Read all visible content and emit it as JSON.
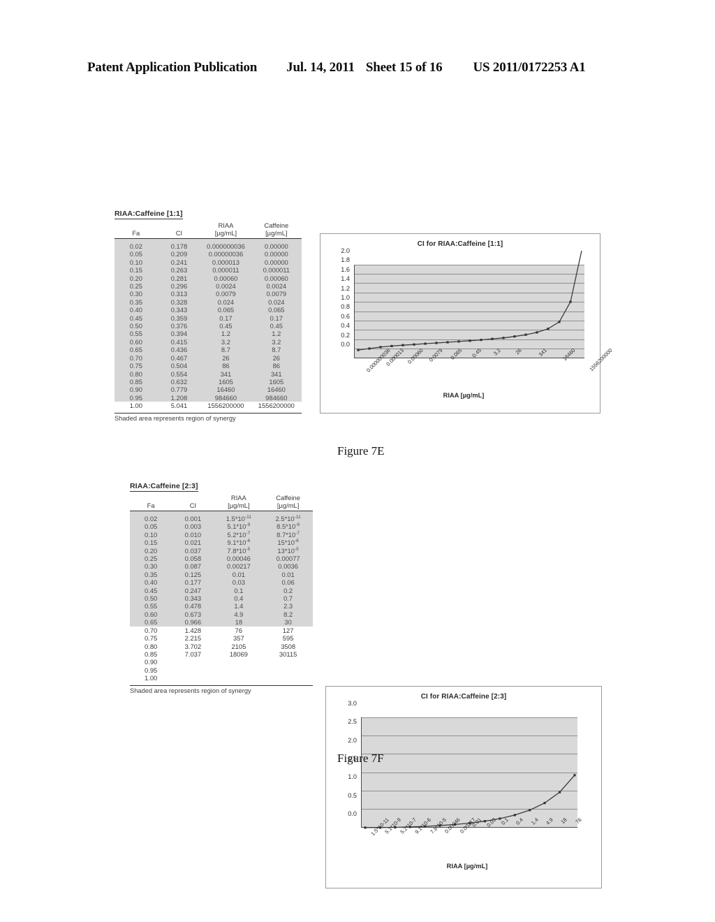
{
  "header": {
    "publication": "Patent Application Publication",
    "date": "Jul. 14, 2011",
    "sheet": "Sheet 15 of 16",
    "pub_number": "US 2011/0172253 A1"
  },
  "figure_7e": {
    "caption": "Figure 7E",
    "table": {
      "title": "RIAA:Caffeine [1:1]",
      "columns": [
        "Fa",
        "CI",
        "RIAA [µg/mL]",
        "Caffeine [µg/mL]"
      ],
      "column_top": [
        "",
        "",
        "RIAA",
        "Caffeine"
      ],
      "column_bottom": [
        "Fa",
        "CI",
        "[µg/mL]",
        "[µg/mL]"
      ],
      "footnote": "Shaded area represents region of synergy",
      "rows": [
        {
          "fa": "0.02",
          "ci": "0.178",
          "riaa": "0.000000036",
          "caffeine": "0.00000",
          "shaded": true
        },
        {
          "fa": "0.05",
          "ci": "0.209",
          "riaa": "0.00000036",
          "caffeine": "0.00000",
          "shaded": true
        },
        {
          "fa": "0.10",
          "ci": "0.241",
          "riaa": "0.000013",
          "caffeine": "0.00000",
          "shaded": true
        },
        {
          "fa": "0.15",
          "ci": "0.263",
          "riaa": "0.000011",
          "caffeine": "0.000011",
          "shaded": true
        },
        {
          "fa": "0.20",
          "ci": "0.281",
          "riaa": "0.00060",
          "caffeine": "0.00060",
          "shaded": true
        },
        {
          "fa": "0.25",
          "ci": "0.296",
          "riaa": "0.0024",
          "caffeine": "0.0024",
          "shaded": true
        },
        {
          "fa": "0.30",
          "ci": "0.313",
          "riaa": "0.0079",
          "caffeine": "0.0079",
          "shaded": true
        },
        {
          "fa": "0.35",
          "ci": "0.328",
          "riaa": "0.024",
          "caffeine": "0.024",
          "shaded": true
        },
        {
          "fa": "0.40",
          "ci": "0.343",
          "riaa": "0.065",
          "caffeine": "0.065",
          "shaded": true
        },
        {
          "fa": "0.45",
          "ci": "0.359",
          "riaa": "0.17",
          "caffeine": "0.17",
          "shaded": true
        },
        {
          "fa": "0.50",
          "ci": "0.376",
          "riaa": "0.45",
          "caffeine": "0.45",
          "shaded": true
        },
        {
          "fa": "0.55",
          "ci": "0.394",
          "riaa": "1.2",
          "caffeine": "1.2",
          "shaded": true
        },
        {
          "fa": "0.60",
          "ci": "0.415",
          "riaa": "3.2",
          "caffeine": "3.2",
          "shaded": true
        },
        {
          "fa": "0.65",
          "ci": "0.436",
          "riaa": "8.7",
          "caffeine": "8.7",
          "shaded": true
        },
        {
          "fa": "0.70",
          "ci": "0.467",
          "riaa": "26",
          "caffeine": "26",
          "shaded": true
        },
        {
          "fa": "0.75",
          "ci": "0.504",
          "riaa": "86",
          "caffeine": "86",
          "shaded": true
        },
        {
          "fa": "0.80",
          "ci": "0.554",
          "riaa": "341",
          "caffeine": "341",
          "shaded": true
        },
        {
          "fa": "0.85",
          "ci": "0.632",
          "riaa": "1605",
          "caffeine": "1605",
          "shaded": true
        },
        {
          "fa": "0.90",
          "ci": "0.779",
          "riaa": "16460",
          "caffeine": "16460",
          "shaded": true
        },
        {
          "fa": "0.95",
          "ci": "1.208",
          "riaa": "984660",
          "caffeine": "984660",
          "shaded": true
        },
        {
          "fa": "1.00",
          "ci": "5.041",
          "riaa": "1556200000",
          "caffeine": "1556200000",
          "shaded": false
        }
      ]
    },
    "chart_data": {
      "type": "line",
      "title": "CI for RIAA:Caffeine [1:1]",
      "xlabel": "RIAA [µg/mL]",
      "ylabel": "",
      "ylim": [
        0.0,
        2.0
      ],
      "yticks": [
        "0.0",
        "0.2",
        "0.4",
        "0.6",
        "0.8",
        "1.0",
        "1.2",
        "1.4",
        "1.6",
        "1.8",
        "2.0"
      ],
      "grid": true,
      "legend": "none",
      "categories": [
        "0.000000036",
        "0.00000036",
        "0.000013",
        "0.000011",
        "0.00060",
        "0.0024",
        "0.0079",
        "0.024",
        "0.065",
        "0.17",
        "0.45",
        "1.2",
        "3.2",
        "8.7",
        "26",
        "86",
        "341",
        "1605",
        "16460",
        "984660",
        "1556200000"
      ],
      "xtick_labels": [
        "0.000000036",
        "0.000013",
        "0.00060",
        "0.0079",
        "0.065",
        "0.45",
        "3.2",
        "26",
        "341",
        "16460",
        "1556200000"
      ],
      "values": [
        0.178,
        0.209,
        0.241,
        0.263,
        0.281,
        0.296,
        0.313,
        0.328,
        0.343,
        0.359,
        0.376,
        0.394,
        0.415,
        0.436,
        0.467,
        0.504,
        0.554,
        0.632,
        0.779,
        1.208,
        5.041
      ]
    }
  },
  "figure_7f": {
    "caption": "Figure 7F",
    "table": {
      "title": "RIAA:Caffeine [2:3]",
      "columns": [
        "Fa",
        "CI",
        "RIAA [µg/mL]",
        "Caffeine [µg/mL]"
      ],
      "column_top": [
        "",
        "",
        "RIAA",
        "Caffeine"
      ],
      "column_bottom": [
        "Fa",
        "CI",
        "[µg/mL]",
        "[µg/mL]"
      ],
      "footnote": "Shaded area represents region of synergy",
      "rows": [
        {
          "fa": "0.02",
          "ci": "0.001",
          "riaa": "1.5*10",
          "riaa_exp": "-11",
          "caffeine": "2.5*10",
          "caffeine_exp": "-11",
          "shaded": true
        },
        {
          "fa": "0.05",
          "ci": "0.003",
          "riaa": "5.1*10",
          "riaa_exp": "-9",
          "caffeine": "8.5*10",
          "caffeine_exp": "-9",
          "shaded": true
        },
        {
          "fa": "0.10",
          "ci": "0.010",
          "riaa": "5.2*10",
          "riaa_exp": "-7",
          "caffeine": "8.7*10",
          "caffeine_exp": "-7",
          "shaded": true
        },
        {
          "fa": "0.15",
          "ci": "0.021",
          "riaa": "9.1*10",
          "riaa_exp": "-6",
          "caffeine": "15*10",
          "caffeine_exp": "-6",
          "shaded": true
        },
        {
          "fa": "0.20",
          "ci": "0.037",
          "riaa": "7.8*10",
          "riaa_exp": "-5",
          "caffeine": "13*10",
          "caffeine_exp": "-5",
          "shaded": true
        },
        {
          "fa": "0.25",
          "ci": "0.058",
          "riaa": "0.00046",
          "riaa_exp": "",
          "caffeine": "0.00077",
          "caffeine_exp": "",
          "shaded": true
        },
        {
          "fa": "0.30",
          "ci": "0.087",
          "riaa": "0.00217",
          "riaa_exp": "",
          "caffeine": "0.0036",
          "caffeine_exp": "",
          "shaded": true
        },
        {
          "fa": "0.35",
          "ci": "0.125",
          "riaa": "0.01",
          "riaa_exp": "",
          "caffeine": "0.01",
          "caffeine_exp": "",
          "shaded": true
        },
        {
          "fa": "0.40",
          "ci": "0.177",
          "riaa": "0.03",
          "riaa_exp": "",
          "caffeine": "0.06",
          "caffeine_exp": "",
          "shaded": true
        },
        {
          "fa": "0.45",
          "ci": "0.247",
          "riaa": "0.1",
          "riaa_exp": "",
          "caffeine": "0.2",
          "caffeine_exp": "",
          "shaded": true
        },
        {
          "fa": "0.50",
          "ci": "0.343",
          "riaa": "0.4",
          "riaa_exp": "",
          "caffeine": "0.7",
          "caffeine_exp": "",
          "shaded": true
        },
        {
          "fa": "0.55",
          "ci": "0.478",
          "riaa": "1.4",
          "riaa_exp": "",
          "caffeine": "2.3",
          "caffeine_exp": "",
          "shaded": true
        },
        {
          "fa": "0.60",
          "ci": "0.673",
          "riaa": "4.9",
          "riaa_exp": "",
          "caffeine": "8.2",
          "caffeine_exp": "",
          "shaded": true
        },
        {
          "fa": "0.65",
          "ci": "0.966",
          "riaa": "18",
          "riaa_exp": "",
          "caffeine": "30",
          "caffeine_exp": "",
          "shaded": true
        },
        {
          "fa": "0.70",
          "ci": "1.428",
          "riaa": "76",
          "riaa_exp": "",
          "caffeine": "127",
          "caffeine_exp": "",
          "shaded": false
        },
        {
          "fa": "0.75",
          "ci": "2.215",
          "riaa": "357",
          "riaa_exp": "",
          "caffeine": "595",
          "caffeine_exp": "",
          "shaded": false
        },
        {
          "fa": "0.80",
          "ci": "3.702",
          "riaa": "2105",
          "riaa_exp": "",
          "caffeine": "3508",
          "caffeine_exp": "",
          "shaded": false
        },
        {
          "fa": "0.85",
          "ci": "7.037",
          "riaa": "18069",
          "riaa_exp": "",
          "caffeine": "30115",
          "caffeine_exp": "",
          "shaded": false
        },
        {
          "fa": "0.90",
          "ci": "",
          "riaa": "",
          "riaa_exp": "",
          "caffeine": "",
          "caffeine_exp": "",
          "shaded": false
        },
        {
          "fa": "0.95",
          "ci": "",
          "riaa": "",
          "riaa_exp": "",
          "caffeine": "",
          "caffeine_exp": "",
          "shaded": false
        },
        {
          "fa": "1.00",
          "ci": "",
          "riaa": "",
          "riaa_exp": "",
          "caffeine": "",
          "caffeine_exp": "",
          "shaded": false
        }
      ]
    },
    "chart_data": {
      "type": "line",
      "title": "CI for RIAA:Caffeine [2:3]",
      "xlabel": "RIAA [µg/mL]",
      "ylabel": "",
      "ylim": [
        0.0,
        3.0
      ],
      "yticks": [
        "0.0",
        "0.5",
        "1.0",
        "1.5",
        "2.0",
        "2.5",
        "3.0"
      ],
      "grid": true,
      "legend": "none",
      "categories": [
        "1.5*10-11",
        "5.1*10-9",
        "5.2*10-7",
        "9.1*10-6",
        "7.8*10-5",
        "0.00046",
        "0.00217",
        "0.01",
        "0.03",
        "0.1",
        "0.4",
        "1.4",
        "4.9",
        "18",
        "76"
      ],
      "xtick_labels": [
        "1.5*10-11",
        "5.1*10-9",
        "5.2*10-7",
        "9.1*10-6",
        "7.8*10-5",
        "0.00046",
        "0.00217",
        "0.01",
        "0.03",
        "0.1",
        "0.4",
        "1.4",
        "4.9",
        "18",
        "76"
      ],
      "values": [
        0.001,
        0.003,
        0.01,
        0.021,
        0.037,
        0.058,
        0.087,
        0.125,
        0.177,
        0.247,
        0.343,
        0.478,
        0.673,
        0.966,
        1.428
      ]
    }
  }
}
